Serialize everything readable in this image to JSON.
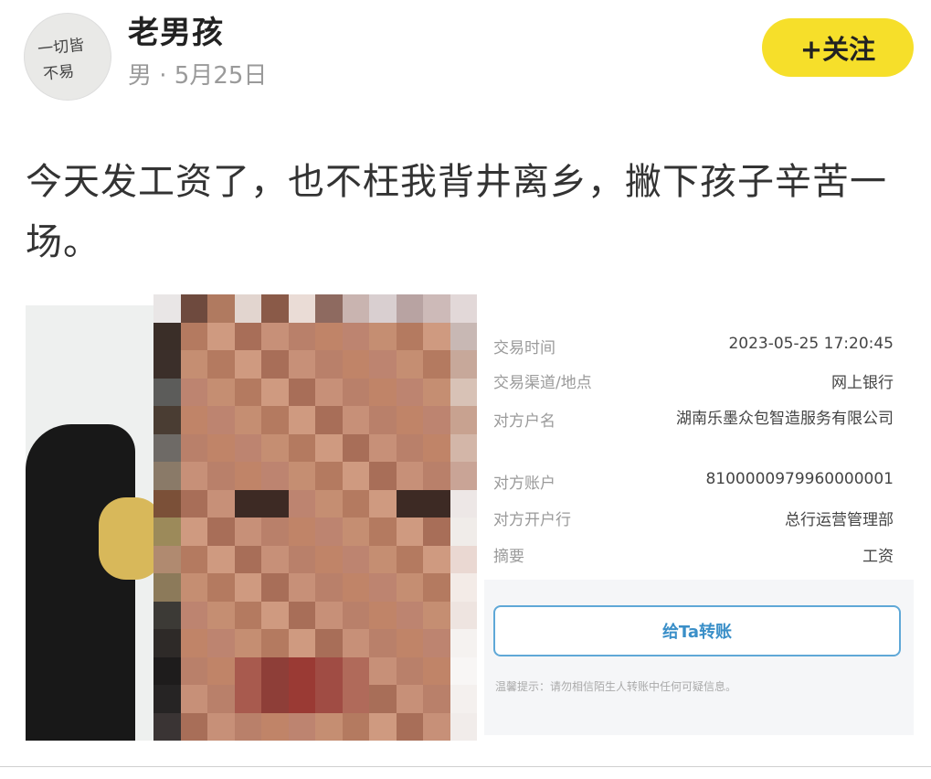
{
  "user": {
    "avatar_scribble_line1": "一切皆",
    "avatar_scribble_line2": "不易",
    "name": "老男孩",
    "meta": "男 · 5月25日"
  },
  "follow_button": {
    "label": "+关注"
  },
  "post": {
    "text": "今天发工资了，也不枉我背井离乡，撇下孩子辛苦一场。"
  },
  "receipt": {
    "rows": [
      {
        "label": "交易时间",
        "value": "2023-05-25 17:20:45"
      },
      {
        "label": "交易渠道/地点",
        "value": "网上银行"
      },
      {
        "label": "对方户名",
        "value": "湖南乐墨众包智造服务有限公司"
      },
      {
        "label": "对方账户",
        "value": "8100000979960000001"
      },
      {
        "label": "对方开户行",
        "value": "总行运营管理部"
      },
      {
        "label": "摘要",
        "value": "工资"
      }
    ],
    "transfer_button": "给Ta转账",
    "tip": "温馨提示：请勿相信陌生人转账中任何可疑信息。"
  },
  "colors": {
    "follow_bg": "#f6df2a",
    "transfer_border": "#5fa8d7",
    "transfer_text": "#3a8fc8"
  }
}
